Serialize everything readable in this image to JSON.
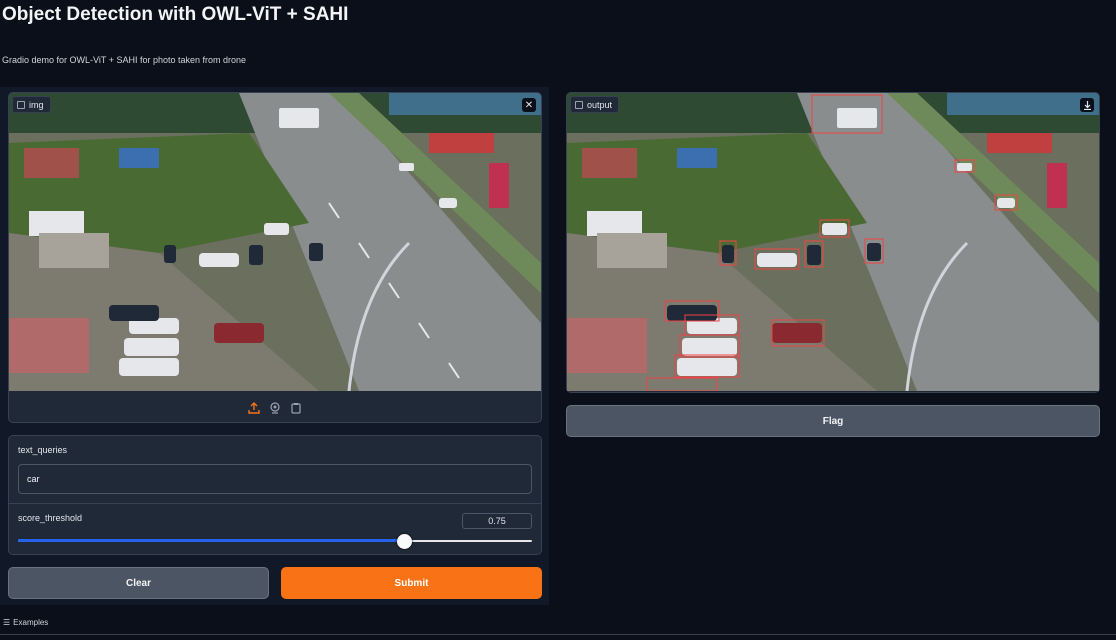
{
  "header": {
    "title": "Object Detection with OWL-ViT + SAHI",
    "subtitle": "Gradio demo for OWL-ViT + SAHI for photo taken from drone"
  },
  "input_image": {
    "label": "img",
    "close_icon": "close-icon",
    "tools": [
      "upload-icon",
      "webcam-icon",
      "clipboard-icon"
    ]
  },
  "output_image": {
    "label": "output",
    "download_icon": "download-icon"
  },
  "text_queries": {
    "label": "text_queries",
    "value": "car"
  },
  "score_threshold": {
    "label": "score_threshold",
    "value": "0.75",
    "fraction": 0.75
  },
  "buttons": {
    "clear": "Clear",
    "submit": "Submit",
    "flag": "Flag"
  },
  "examples": {
    "label": "Examples"
  },
  "colors": {
    "accent": "#f97316",
    "slider": "#2563eb",
    "background": "#0b0f19"
  }
}
